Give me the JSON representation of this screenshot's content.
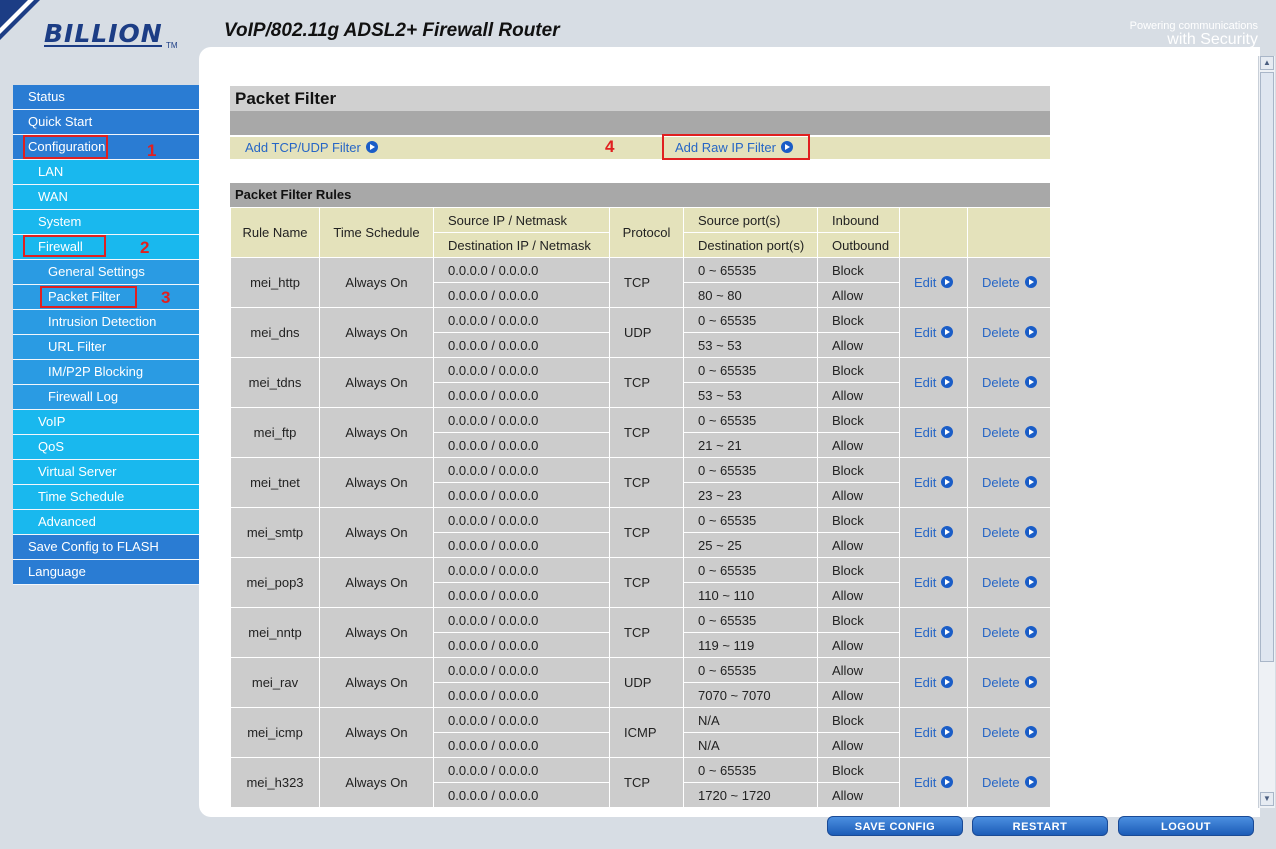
{
  "header": {
    "logo_text": "BILLION",
    "logo_tm": "TM",
    "title": "VoIP/802.11g ADSL2+ Firewall Router",
    "tagline_powering": "Powering communications",
    "tagline_security": "with Security"
  },
  "sidebar": {
    "items": [
      {
        "label": "Status",
        "level": 1
      },
      {
        "label": "Quick Start",
        "level": 1
      },
      {
        "label": "Configuration",
        "level": 1
      },
      {
        "label": "LAN",
        "level": 2
      },
      {
        "label": "WAN",
        "level": 2
      },
      {
        "label": "System",
        "level": 2
      },
      {
        "label": "Firewall",
        "level": 2
      },
      {
        "label": "General Settings",
        "level": 3
      },
      {
        "label": "Packet Filter",
        "level": 3
      },
      {
        "label": "Intrusion Detection",
        "level": 3
      },
      {
        "label": "URL Filter",
        "level": 3
      },
      {
        "label": "IM/P2P Blocking",
        "level": 3
      },
      {
        "label": "Firewall Log",
        "level": 3
      },
      {
        "label": "VoIP",
        "level": 2
      },
      {
        "label": "QoS",
        "level": 2
      },
      {
        "label": "Virtual Server",
        "level": 2
      },
      {
        "label": "Time Schedule",
        "level": 2
      },
      {
        "label": "Advanced",
        "level": 2
      },
      {
        "label": "Save Config to FLASH",
        "level": 1
      },
      {
        "label": "Language",
        "level": 1
      }
    ]
  },
  "annotations": {
    "n1": "1",
    "n2": "2",
    "n3": "3",
    "n4": "4"
  },
  "page": {
    "title": "Packet Filter",
    "add_tcp_udp": "Add TCP/UDP Filter",
    "add_raw_ip": "Add Raw IP Filter",
    "rules_title": "Packet Filter Rules"
  },
  "table": {
    "headers": {
      "rule_name": "Rule Name",
      "time_schedule": "Time Schedule",
      "src_ip": "Source IP / Netmask",
      "dst_ip": "Destination IP / Netmask",
      "protocol": "Protocol",
      "src_port": "Source port(s)",
      "dst_port": "Destination port(s)",
      "inbound": "Inbound",
      "outbound": "Outbound"
    },
    "edit_label": "Edit",
    "delete_label": "Delete",
    "rows": [
      {
        "name": "mei_http",
        "schedule": "Always On",
        "src_ip": "0.0.0.0 / 0.0.0.0",
        "dst_ip": "0.0.0.0 / 0.0.0.0",
        "protocol": "TCP",
        "src_port": "0 ~ 65535",
        "dst_port": "80 ~ 80",
        "inbound": "Block",
        "outbound": "Allow"
      },
      {
        "name": "mei_dns",
        "schedule": "Always On",
        "src_ip": "0.0.0.0 / 0.0.0.0",
        "dst_ip": "0.0.0.0 / 0.0.0.0",
        "protocol": "UDP",
        "src_port": "0 ~ 65535",
        "dst_port": "53 ~ 53",
        "inbound": "Block",
        "outbound": "Allow"
      },
      {
        "name": "mei_tdns",
        "schedule": "Always On",
        "src_ip": "0.0.0.0 / 0.0.0.0",
        "dst_ip": "0.0.0.0 / 0.0.0.0",
        "protocol": "TCP",
        "src_port": "0 ~ 65535",
        "dst_port": "53 ~ 53",
        "inbound": "Block",
        "outbound": "Allow"
      },
      {
        "name": "mei_ftp",
        "schedule": "Always On",
        "src_ip": "0.0.0.0 / 0.0.0.0",
        "dst_ip": "0.0.0.0 / 0.0.0.0",
        "protocol": "TCP",
        "src_port": "0 ~ 65535",
        "dst_port": "21 ~ 21",
        "inbound": "Block",
        "outbound": "Allow"
      },
      {
        "name": "mei_tnet",
        "schedule": "Always On",
        "src_ip": "0.0.0.0 / 0.0.0.0",
        "dst_ip": "0.0.0.0 / 0.0.0.0",
        "protocol": "TCP",
        "src_port": "0 ~ 65535",
        "dst_port": "23 ~ 23",
        "inbound": "Block",
        "outbound": "Allow"
      },
      {
        "name": "mei_smtp",
        "schedule": "Always On",
        "src_ip": "0.0.0.0 / 0.0.0.0",
        "dst_ip": "0.0.0.0 / 0.0.0.0",
        "protocol": "TCP",
        "src_port": "0 ~ 65535",
        "dst_port": "25 ~ 25",
        "inbound": "Block",
        "outbound": "Allow"
      },
      {
        "name": "mei_pop3",
        "schedule": "Always On",
        "src_ip": "0.0.0.0 / 0.0.0.0",
        "dst_ip": "0.0.0.0 / 0.0.0.0",
        "protocol": "TCP",
        "src_port": "0 ~ 65535",
        "dst_port": "110 ~ 110",
        "inbound": "Block",
        "outbound": "Allow"
      },
      {
        "name": "mei_nntp",
        "schedule": "Always On",
        "src_ip": "0.0.0.0 / 0.0.0.0",
        "dst_ip": "0.0.0.0 / 0.0.0.0",
        "protocol": "TCP",
        "src_port": "0 ~ 65535",
        "dst_port": "119 ~ 119",
        "inbound": "Block",
        "outbound": "Allow"
      },
      {
        "name": "mei_rav",
        "schedule": "Always On",
        "src_ip": "0.0.0.0 / 0.0.0.0",
        "dst_ip": "0.0.0.0 / 0.0.0.0",
        "protocol": "UDP",
        "src_port": "0 ~ 65535",
        "dst_port": "7070 ~ 7070",
        "inbound": "Allow",
        "outbound": "Allow"
      },
      {
        "name": "mei_icmp",
        "schedule": "Always On",
        "src_ip": "0.0.0.0 / 0.0.0.0",
        "dst_ip": "0.0.0.0 / 0.0.0.0",
        "protocol": "ICMP",
        "src_port": "N/A",
        "dst_port": "N/A",
        "inbound": "Block",
        "outbound": "Allow"
      },
      {
        "name": "mei_h323",
        "schedule": "Always On",
        "src_ip": "0.0.0.0 / 0.0.0.0",
        "dst_ip": "0.0.0.0 / 0.0.0.0",
        "protocol": "TCP",
        "src_port": "0 ~ 65535",
        "dst_port": "1720 ~ 1720",
        "inbound": "Block",
        "outbound": "Allow"
      }
    ]
  },
  "footer": {
    "save_config": "SAVE CONFIG",
    "restart": "RESTART",
    "logout": "LOGOUT"
  },
  "colors": {
    "nav_level1": "#2a7cd3",
    "nav_level2": "#19b8ee",
    "nav_level3": "#2a9be3",
    "table_header": "#e4e2bb",
    "table_cell": "#cccccc",
    "link": "#2666c6",
    "annotation": "#e02020"
  }
}
